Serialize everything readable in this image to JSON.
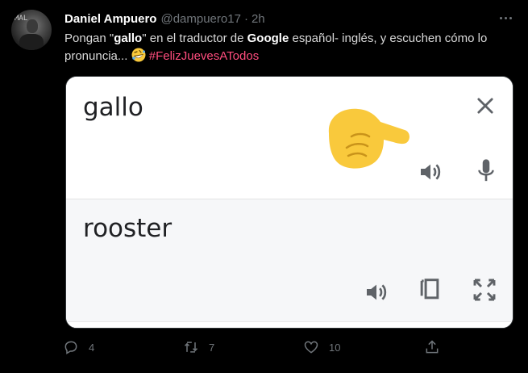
{
  "tweet": {
    "author_name": "Daniel Ampuero",
    "handle": "@dampuero17",
    "separator": "·",
    "time": "2h",
    "avatar_text": "MAL",
    "text_part1": "Pongan \"",
    "text_bold1": "gallo",
    "text_part2": "\" en el traductor de ",
    "text_bold2": "Google",
    "text_part3": " español- inglés, y escuchen cómo lo pronuncia... ",
    "emoji": "rolling-on-floor-laughing",
    "hashtag": "#Feliz​JuevesATodos"
  },
  "media": {
    "source_text": "gallo",
    "target_text": "rooster",
    "icons": {
      "close": "close-icon",
      "source_speaker": "speaker-icon",
      "microphone": "microphone-icon",
      "target_speaker": "speaker-icon",
      "copy": "copy-icon",
      "fullscreen": "fullscreen-icon",
      "overlay": "pointing-hand-emoji"
    }
  },
  "actions": {
    "replies": "4",
    "retweets": "7",
    "likes": "10"
  },
  "colors": {
    "background": "#000000",
    "text": "#d9d9d9",
    "muted": "#71767b",
    "hashtag": "#ff4d7e",
    "hand": "#f9c93c",
    "google_icon": "#5f6368"
  }
}
